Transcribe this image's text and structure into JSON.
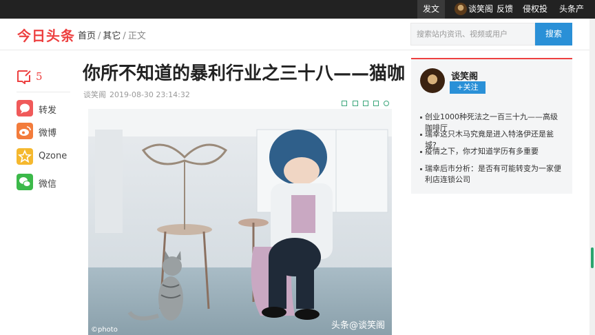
{
  "topbar": {
    "publish": "发文",
    "user_name": "谈笑阁",
    "feedback": "反馈",
    "report": "侵权投诉",
    "products": "头条产品"
  },
  "header": {
    "logo": "今日头条",
    "breadcrumb": [
      "首页",
      "其它",
      "正文"
    ],
    "search_placeholder": "搜索站内资讯、视频或用户",
    "search_button": "搜索"
  },
  "share": {
    "comment_count": "5",
    "items": [
      {
        "label": "转发",
        "icon": "repost-icon",
        "color": "#f05a5a"
      },
      {
        "label": "微博",
        "icon": "weibo-icon",
        "color": "#f37c3c"
      },
      {
        "label": "Qzone",
        "icon": "qzone-icon",
        "color": "#f5b82e"
      },
      {
        "label": "微信",
        "icon": "wechat-icon",
        "color": "#3cb94a"
      }
    ]
  },
  "article": {
    "title": "你所不知道的暴利行业之三十八——猫咖",
    "author": "谈笑阁",
    "datetime": "2019-08-30 23:14:32",
    "watermark": "头条@谈笑阁",
    "credit": "©photo"
  },
  "author_card": {
    "name": "谈笑阁",
    "follow": "+关注",
    "recommendations": [
      "创业1000种死法之一百三十九——高级咖啡厅",
      "瑞幸这只木马究竟是进入特洛伊还是瓮城?",
      "疫情之下，你才知道学历有多重要",
      "瑞幸后市分析：是否有可能转变为一家便利店连锁公司"
    ]
  },
  "colors": {
    "brand_red": "#ed4040",
    "accent_blue": "#2a90d7",
    "topbar": "#222222"
  }
}
